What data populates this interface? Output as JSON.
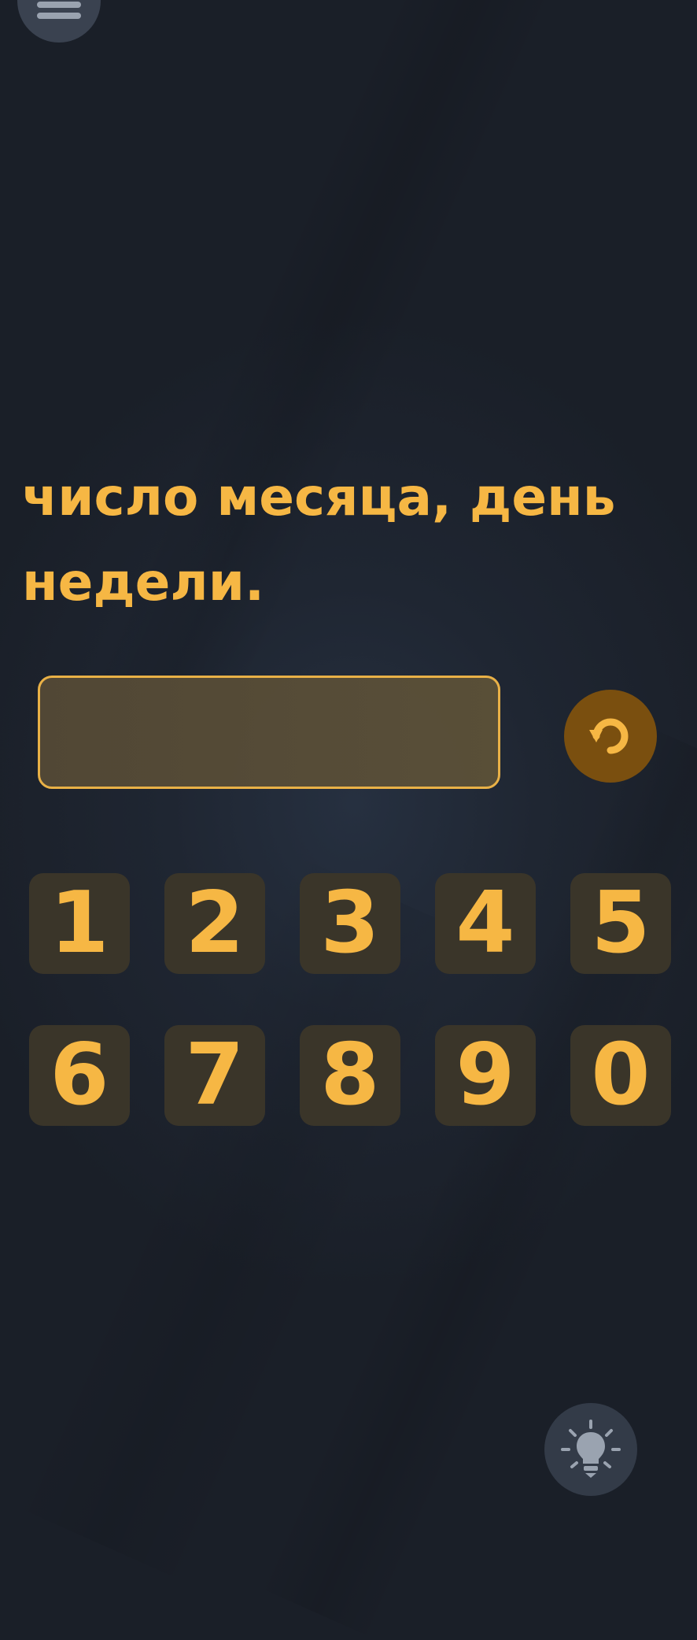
{
  "menu": {
    "icon": "menu-icon"
  },
  "question": {
    "line1": "число месяца, день",
    "line2": "недели."
  },
  "answer": {
    "value": ""
  },
  "reset": {
    "icon": "reset-icon"
  },
  "keypad": {
    "row1": [
      "1",
      "2",
      "3",
      "4",
      "5"
    ],
    "row2": [
      "6",
      "7",
      "8",
      "9",
      "0"
    ]
  },
  "hint": {
    "icon": "lightbulb-icon"
  },
  "colors": {
    "accent": "#f6b744",
    "background": "#1f2632",
    "key_background": "#3a3529",
    "reset_background": "#7a4f0f"
  }
}
